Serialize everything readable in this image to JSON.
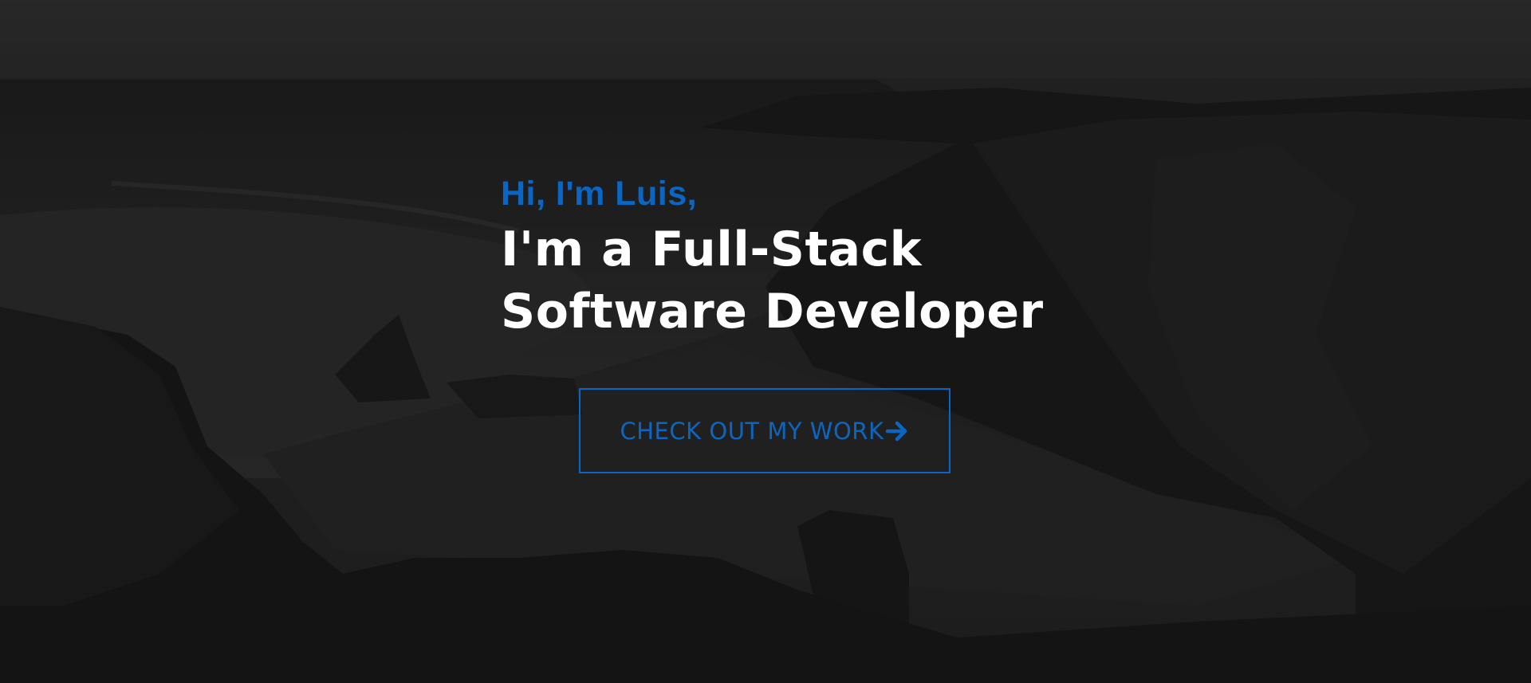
{
  "hero": {
    "greeting": "Hi, I'm Luis,",
    "headline_line1": "I'm a Full-Stack",
    "headline_line2": "Software Developer",
    "cta_label": "CHECK OUT MY WORK",
    "cta_icon": "arrow-right-icon",
    "background_image": "coastal-cliffs-photo"
  },
  "colors": {
    "accent": "#0b66c3",
    "headline": "#ffffff",
    "overlay": "#1e1e1e"
  }
}
